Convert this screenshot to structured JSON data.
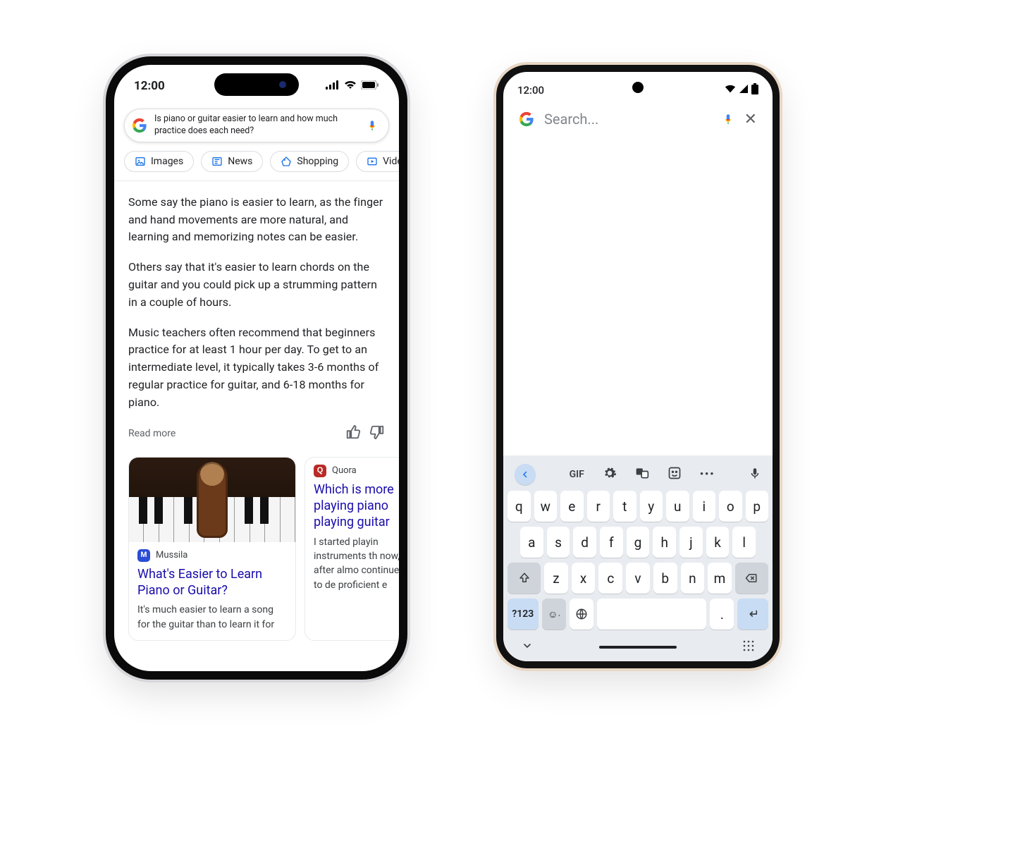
{
  "iphone": {
    "status_time": "12:00",
    "search_query": "Is piano or guitar easier to learn and how much practice does each need?",
    "chips": [
      "Images",
      "News",
      "Shopping",
      "Vide"
    ],
    "para1": "Some say the piano is easier to learn, as the finger and hand movements are more natural, and learning and memorizing notes can be easier.",
    "para2": "Others say that it's easier to learn chords on the guitar and you could pick up a strumming pattern in a couple of hours.",
    "para3": "Music teachers often recommend that beginners practice for at least 1 hour per day. To get to an intermediate level, it typically takes 3-6 months of regular practice for guitar, and 6-18 months for piano.",
    "read_more": "Read more",
    "card1": {
      "source": "Mussila",
      "title": "What's Easier to Learn Piano or Guitar?",
      "body": "It's much easier to learn a song for the guitar than to learn it for"
    },
    "card2": {
      "source": "Quora",
      "title": "Which is more playing piano playing guitar",
      "body": "I started playin instruments th now, after almo continue to de proficient e"
    }
  },
  "pixel": {
    "status_time": "12:00",
    "search_placeholder": "Search...",
    "toolbar_gif": "GIF",
    "row1": [
      "q",
      "w",
      "e",
      "r",
      "t",
      "y",
      "u",
      "i",
      "o",
      "p"
    ],
    "row2": [
      "a",
      "s",
      "d",
      "f",
      "g",
      "h",
      "j",
      "k",
      "l"
    ],
    "row3": [
      "z",
      "x",
      "c",
      "v",
      "b",
      "n",
      "m"
    ],
    "sym_key": "?123",
    "period_key": "."
  }
}
